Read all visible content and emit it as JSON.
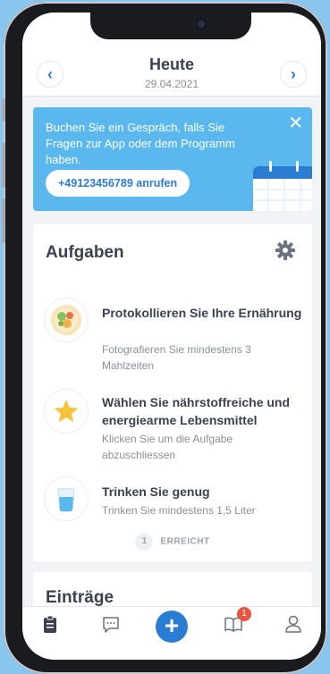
{
  "header": {
    "title": "Heute",
    "date": "29.04.2021",
    "prev_icon": "chevron-left-icon",
    "next_icon": "chevron-right-icon"
  },
  "banner": {
    "text": "Buchen Sie ein Gespräch, falls Sie Fragen zur App oder dem Programm haben.",
    "call_label": "+49123456789 anrufen",
    "close_icon": "close-icon",
    "bg_color": "#5ab8ef"
  },
  "tasks_card": {
    "title": "Aufgaben",
    "tasks": [
      {
        "title": "Protokollieren Sie Ihre Ernährung",
        "subtitle": "Fotografieren Sie mindestens 3 Mahlzeiten",
        "icon": "food-plate-icon"
      },
      {
        "title": "Wählen Sie nährstoffreiche und energiearme Lebensmittel",
        "subtitle": "Klicken Sie um die Aufgabe abzuschliessen",
        "icon": "star-icon"
      },
      {
        "title": "Trinken Sie genug",
        "subtitle": "Trinken Sie mindestens 1,5 Liter",
        "icon": "water-glass-icon"
      }
    ],
    "reached_count": "1",
    "reached_label": "ERREICHT"
  },
  "entries_card": {
    "title": "Einträge"
  },
  "tabbar": {
    "badge_count": "1",
    "accent": "#2b7cd3"
  }
}
